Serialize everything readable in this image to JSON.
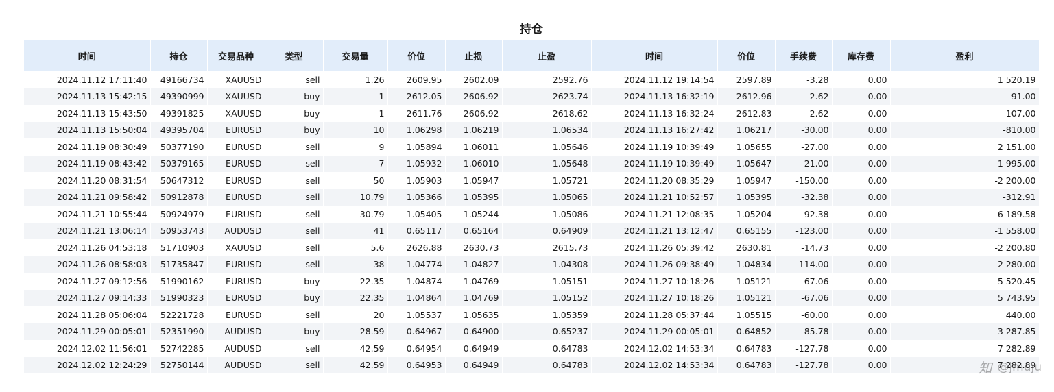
{
  "title": "持仓",
  "columns": [
    "时间",
    "持仓",
    "交易品种",
    "类型",
    "交易量",
    "价位",
    "止损",
    "止盈",
    "时间",
    "价位",
    "手续费",
    "库存费",
    "盈利"
  ],
  "rows": [
    [
      "2024.11.12 17:11:40",
      "49166734",
      "XAUUSD",
      "sell",
      "1.26",
      "2609.95",
      "2602.09",
      "2592.76",
      "2024.11.12 19:14:54",
      "2597.89",
      "-3.28",
      "0.00",
      "1 520.19"
    ],
    [
      "2024.11.13 15:42:15",
      "49390999",
      "XAUUSD",
      "buy",
      "1",
      "2612.05",
      "2606.92",
      "2623.74",
      "2024.11.13 16:32:19",
      "2612.96",
      "-2.62",
      "0.00",
      "91.00"
    ],
    [
      "2024.11.13 15:43:50",
      "49391825",
      "XAUUSD",
      "buy",
      "1",
      "2611.76",
      "2606.92",
      "2618.62",
      "2024.11.13 16:32:24",
      "2612.83",
      "-2.62",
      "0.00",
      "107.00"
    ],
    [
      "2024.11.13 15:50:04",
      "49395704",
      "EURUSD",
      "buy",
      "10",
      "1.06298",
      "1.06219",
      "1.06534",
      "2024.11.13 16:27:42",
      "1.06217",
      "-30.00",
      "0.00",
      "-810.00"
    ],
    [
      "2024.11.19 08:30:49",
      "50377190",
      "EURUSD",
      "sell",
      "9",
      "1.05894",
      "1.06011",
      "1.05646",
      "2024.11.19 10:39:49",
      "1.05655",
      "-27.00",
      "0.00",
      "2 151.00"
    ],
    [
      "2024.11.19 08:43:42",
      "50379165",
      "EURUSD",
      "sell",
      "7",
      "1.05932",
      "1.06010",
      "1.05648",
      "2024.11.19 10:39:49",
      "1.05647",
      "-21.00",
      "0.00",
      "1 995.00"
    ],
    [
      "2024.11.20 08:31:54",
      "50647312",
      "EURUSD",
      "sell",
      "50",
      "1.05903",
      "1.05947",
      "1.05721",
      "2024.11.20 08:35:29",
      "1.05947",
      "-150.00",
      "0.00",
      "-2 200.00"
    ],
    [
      "2024.11.21 09:58:42",
      "50912878",
      "EURUSD",
      "sell",
      "10.79",
      "1.05366",
      "1.05395",
      "1.05065",
      "2024.11.21 10:52:57",
      "1.05395",
      "-32.38",
      "0.00",
      "-312.91"
    ],
    [
      "2024.11.21 10:55:44",
      "50924979",
      "EURUSD",
      "sell",
      "30.79",
      "1.05405",
      "1.05244",
      "1.05086",
      "2024.11.21 12:08:35",
      "1.05204",
      "-92.38",
      "0.00",
      "6 189.58"
    ],
    [
      "2024.11.21 13:06:14",
      "50953743",
      "AUDUSD",
      "sell",
      "41",
      "0.65117",
      "0.65164",
      "0.64909",
      "2024.11.21 13:12:47",
      "0.65155",
      "-123.00",
      "0.00",
      "-1 558.00"
    ],
    [
      "2024.11.26 04:53:18",
      "51710903",
      "XAUUSD",
      "sell",
      "5.6",
      "2626.88",
      "2630.73",
      "2615.73",
      "2024.11.26 05:39:42",
      "2630.81",
      "-14.73",
      "0.00",
      "-2 200.80"
    ],
    [
      "2024.11.26 08:58:03",
      "51735847",
      "EURUSD",
      "sell",
      "38",
      "1.04774",
      "1.04827",
      "1.04308",
      "2024.11.26 09:38:49",
      "1.04834",
      "-114.00",
      "0.00",
      "-2 280.00"
    ],
    [
      "2024.11.27 09:12:56",
      "51990162",
      "EURUSD",
      "buy",
      "22.35",
      "1.04874",
      "1.04769",
      "1.05151",
      "2024.11.27 10:18:26",
      "1.05121",
      "-67.06",
      "0.00",
      "5 520.45"
    ],
    [
      "2024.11.27 09:14:33",
      "51990323",
      "EURUSD",
      "buy",
      "22.35",
      "1.04864",
      "1.04769",
      "1.05152",
      "2024.11.27 10:18:26",
      "1.05121",
      "-67.06",
      "0.00",
      "5 743.95"
    ],
    [
      "2024.11.28 05:06:04",
      "52221728",
      "EURUSD",
      "sell",
      "20",
      "1.05537",
      "1.05635",
      "1.05359",
      "2024.11.28 05:37:44",
      "1.05515",
      "-60.00",
      "0.00",
      "440.00"
    ],
    [
      "2024.11.29 00:05:01",
      "52351990",
      "AUDUSD",
      "buy",
      "28.59",
      "0.64967",
      "0.64900",
      "0.65237",
      "2024.11.29 00:05:01",
      "0.64852",
      "-85.78",
      "0.00",
      "-3 287.85"
    ],
    [
      "2024.12.02 11:56:01",
      "52742285",
      "AUDUSD",
      "sell",
      "42.59",
      "0.64954",
      "0.64949",
      "0.64783",
      "2024.12.02 14:53:34",
      "0.64783",
      "-127.78",
      "0.00",
      "7 282.89"
    ],
    [
      "2024.12.02 12:24:29",
      "52750144",
      "AUDUSD",
      "sell",
      "42.59",
      "0.64953",
      "0.64949",
      "0.64783",
      "2024.12.02 14:53:34",
      "0.64783",
      "-127.78",
      "0.00",
      "7 282.89"
    ]
  ],
  "watermark": {
    "icon": "zhihu-logo-icon",
    "text": "@jmuju"
  }
}
